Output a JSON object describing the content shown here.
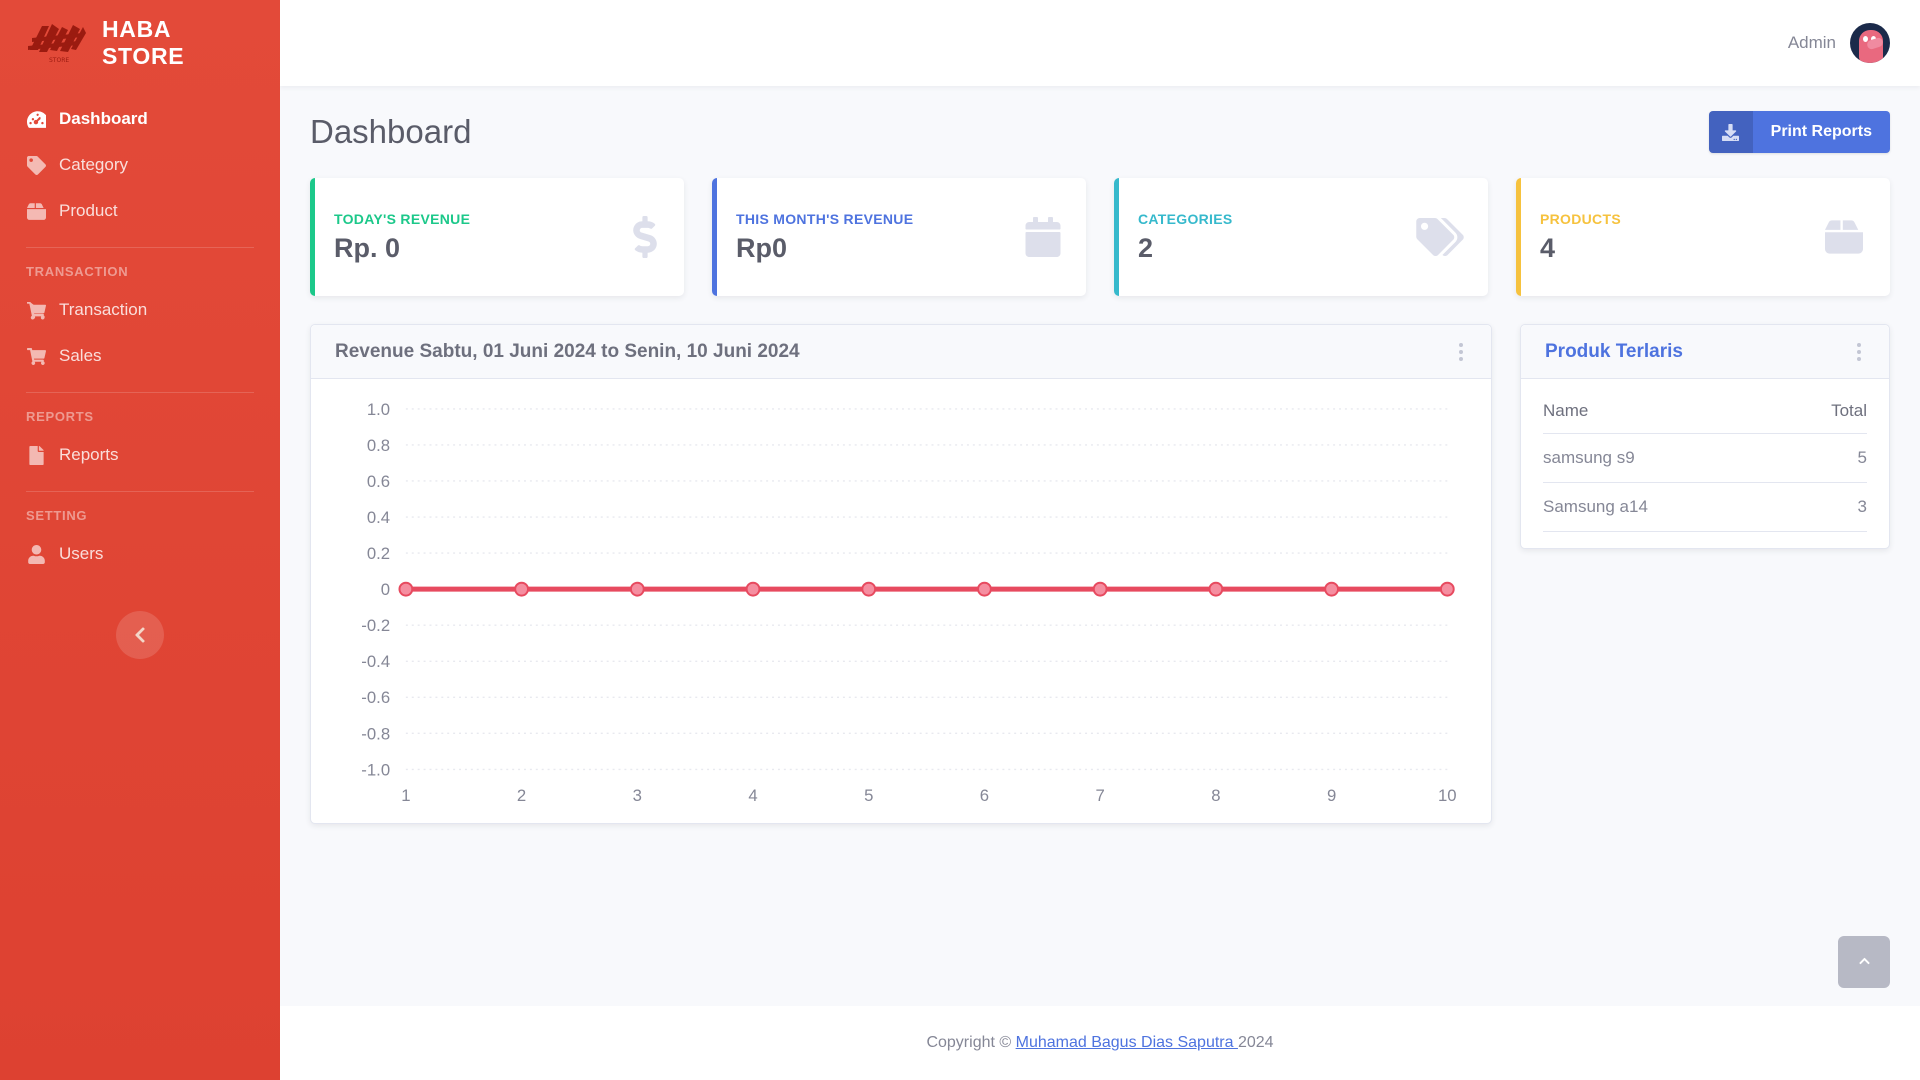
{
  "sidebar": {
    "brand": "HABA STORE",
    "brand_logo_icon": "haba-logo",
    "items": [
      {
        "label": "Dashboard",
        "icon": "tachometer-icon",
        "active": true
      },
      {
        "label": "Category",
        "icon": "tag-icon",
        "active": false
      },
      {
        "label": "Product",
        "icon": "box-icon",
        "active": false
      }
    ],
    "sections": [
      {
        "heading": "TRANSACTION",
        "items": [
          {
            "label": "Transaction",
            "icon": "cart-plus-icon"
          },
          {
            "label": "Sales",
            "icon": "shopping-cart-icon"
          }
        ]
      },
      {
        "heading": "REPORTS",
        "items": [
          {
            "label": "Reports",
            "icon": "file-icon"
          }
        ]
      },
      {
        "heading": "SETTING",
        "items": [
          {
            "label": "Users",
            "icon": "user-icon"
          }
        ]
      }
    ],
    "collapse_icon": "chevron-left-icon",
    "bg_color": "#e04434"
  },
  "topbar": {
    "user_name": "Admin",
    "avatar_icon": "user-avatar"
  },
  "page": {
    "title": "Dashboard",
    "print_button_label": "Print Reports",
    "print_button_icon": "download-icon",
    "print_button_color": "#4e73df"
  },
  "stats": [
    {
      "label": "TODAY'S REVENUE",
      "value": "Rp. 0",
      "color": "#1cc88a",
      "icon": "dollar-sign-icon"
    },
    {
      "label": "THIS MONTH'S REVENUE",
      "value": "Rp0",
      "color": "#4e73df",
      "icon": "calendar-icon"
    },
    {
      "label": "CATEGORIES",
      "value": "2",
      "color": "#36b9cc",
      "icon": "tags-icon"
    },
    {
      "label": "PRODUCTS",
      "value": "4",
      "color": "#f6c23e",
      "icon": "box-open-icon"
    }
  ],
  "chart_card": {
    "title": "Revenue Sabtu, 01 Juni 2024 to Senin, 10 Juni 2024",
    "menu_icon": "kebab-menu-icon"
  },
  "chart_data": {
    "type": "line",
    "title": "Revenue Sabtu, 01 Juni 2024 to Senin, 10 Juni 2024",
    "xlabel": "",
    "ylabel": "",
    "x": [
      1,
      2,
      3,
      4,
      5,
      6,
      7,
      8,
      9,
      10
    ],
    "xticks": [
      "1",
      "2",
      "3",
      "4",
      "5",
      "6",
      "7",
      "8",
      "9",
      "10"
    ],
    "yticks": [
      "1.0",
      "0.8",
      "0.6",
      "0.4",
      "0.2",
      "0",
      "-0.2",
      "-0.4",
      "-0.6",
      "-0.8",
      "-1.0"
    ],
    "ytick_values": [
      1.0,
      0.8,
      0.6,
      0.4,
      0.2,
      0,
      -0.2,
      -0.4,
      -0.6,
      -0.8,
      -1.0
    ],
    "ylim": [
      -1.0,
      1.0
    ],
    "grid": true,
    "legend": false,
    "series": [
      {
        "name": "Revenue",
        "values": [
          0,
          0,
          0,
          0,
          0,
          0,
          0,
          0,
          0,
          0
        ],
        "line_color": "#e74a5f",
        "marker_color": "#f58ea0"
      }
    ]
  },
  "top_products_card": {
    "title": "Produk Terlaris",
    "menu_icon": "kebab-menu-icon",
    "columns": [
      "Name",
      "Total"
    ],
    "rows": [
      {
        "name": "samsung s9",
        "total": "5"
      },
      {
        "name": "Samsung a14",
        "total": "3"
      }
    ]
  },
  "footer": {
    "prefix": "Copyright © ",
    "link": "Muhamad Bagus Dias Saputra ",
    "suffix": "2024"
  },
  "scroll_top": {
    "icon": "chevron-up-icon"
  }
}
